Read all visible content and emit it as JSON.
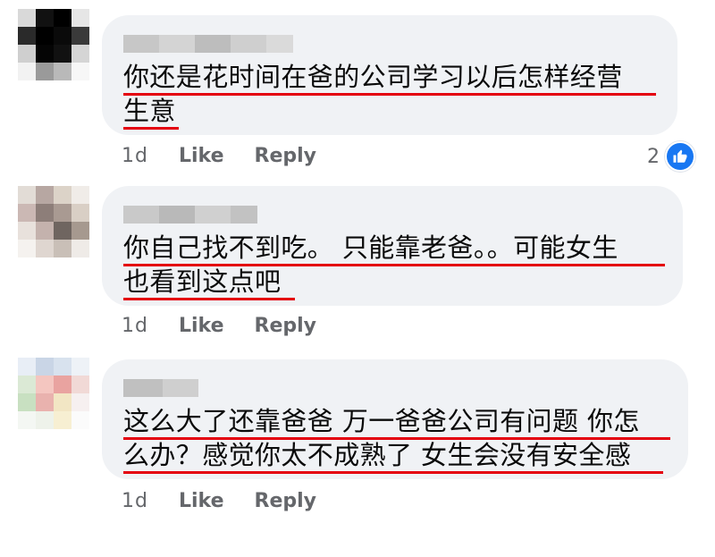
{
  "comments": [
    {
      "lines": [
        "你还是花时间在爸的公司学习以后怎样经营",
        "生意"
      ],
      "time": "1d",
      "like_label": "Like",
      "reply_label": "Reply",
      "reaction_count": "2",
      "reaction_icon": "thumbs-up-icon"
    },
    {
      "lines": [
        "你自己找不到吃。 只能靠老爸。。可能女生",
        "也看到这点吧"
      ],
      "time": "1d",
      "like_label": "Like",
      "reply_label": "Reply"
    },
    {
      "lines": [
        "这么大了还靠爸爸 万一爸爸公司有问题 你怎",
        "么办？感觉你太不成熟了 女生会没有安全感"
      ],
      "time": "1d",
      "like_label": "Like",
      "reply_label": "Reply"
    }
  ],
  "colors": {
    "bubble": "#f0f2f5",
    "underline": "#e4000f",
    "meta_text": "#65676b",
    "like_blue": "#1877f2"
  }
}
